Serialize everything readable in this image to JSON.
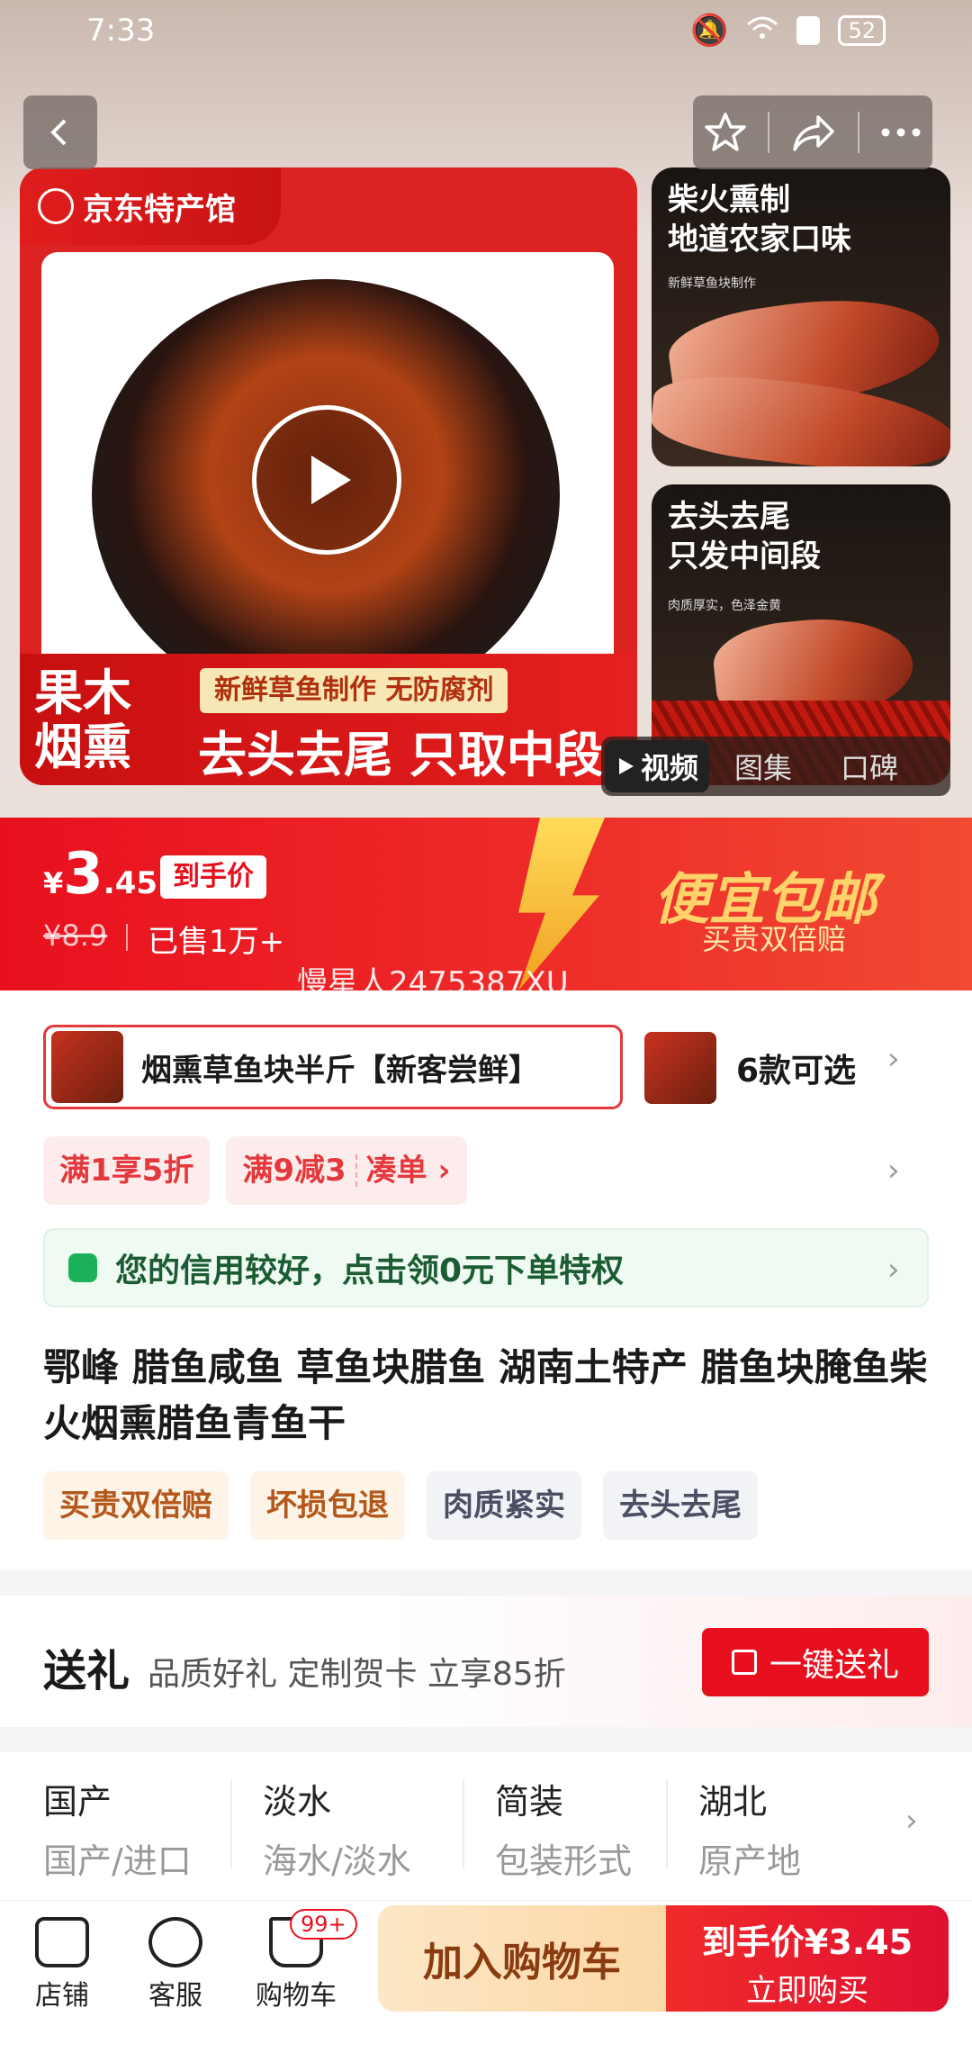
{
  "status_bar": {
    "time": "7:33",
    "battery": "52"
  },
  "gallery": {
    "brand_badge": "京东特产馆",
    "promo_left_line1": "果木",
    "promo_left_line2": "烟熏",
    "promo_sub": "新鲜草鱼制作 无防腐剂",
    "promo_main": "去头去尾 只取中段",
    "side1_title_line1": "柴火熏制",
    "side1_title_line2": "地道农家口味",
    "side1_small": "新鲜草鱼块制作",
    "side2_title_line1": "去头去尾",
    "side2_title_line2": "只发中间段",
    "side2_small": "肉质厚实，色泽金黄",
    "tabs": [
      "视频",
      "图集",
      "口碑"
    ]
  },
  "price": {
    "currency": "¥",
    "int": "3",
    "dec": ".45",
    "hand_price_tag": "到手价",
    "original": "¥8.9",
    "sold": "已售1万+",
    "slogan": "便宜包邮",
    "slogan_sub": "买贵双倍赔",
    "watermark": "慢星人2475387XU"
  },
  "variant": {
    "selected": "烟熏草鱼块半斤【新客尝鲜】",
    "count": "6款可选"
  },
  "promos": {
    "chip1": "满1享5折",
    "chip2_a": "满9减3",
    "chip2_b": "凑单 ›"
  },
  "credit": "您的信用较好，点击领0元下单特权",
  "product_title": "鄂峰 腊鱼咸鱼 草鱼块腊鱼 湖南土特产 腊鱼块腌鱼柴火烟熏腊鱼青鱼干",
  "tags": [
    "买贵双倍赔",
    "坏损包退",
    "肉质紧实",
    "去头去尾"
  ],
  "gift": {
    "heading": "送礼",
    "sub": "品质好礼 定制贺卡 立享85折",
    "button": "一键送礼"
  },
  "specs": [
    {
      "value": "国产",
      "key": "国产/进口"
    },
    {
      "value": "淡水",
      "key": "海水/淡水"
    },
    {
      "value": "简装",
      "key": "包装形式"
    },
    {
      "value": "湖北",
      "key": "原产地"
    }
  ],
  "bottom": {
    "shop": "店铺",
    "service": "客服",
    "cart": "购物车",
    "cart_badge": "99+",
    "add_cart": "加入购物车",
    "buy_price": "到手价¥3.45",
    "buy_now": "立即购买"
  },
  "colors": {
    "accent": "#e8101e",
    "green": "#1bb05a",
    "gold": "#ffd26a"
  }
}
